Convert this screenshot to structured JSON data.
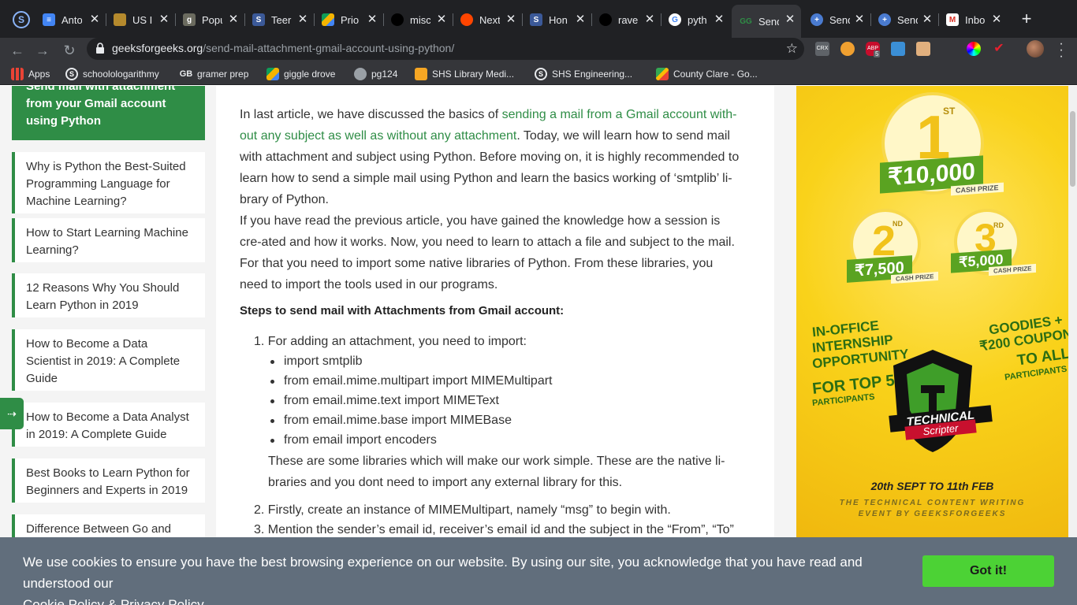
{
  "browser": {
    "app_icon": "S",
    "tabs": [
      {
        "title": "Anto",
        "favicon": "docs-icon",
        "color": "#4285f4"
      },
      {
        "title": "US I",
        "favicon": "folder-icon",
        "color": "#b58a2d"
      },
      {
        "title": "Popu",
        "favicon": "g-icon",
        "color": "#6b6b5f"
      },
      {
        "title": "Teer",
        "favicon": "s-icon",
        "color": "#3b5998"
      },
      {
        "title": "Prio",
        "favicon": "drive-icon",
        "color": "#0f9d58"
      },
      {
        "title": "misc",
        "favicon": "github-icon",
        "color": "#000000"
      },
      {
        "title": "Next",
        "favicon": "reddit-icon",
        "color": "#ff4500"
      },
      {
        "title": "Hon",
        "favicon": "s-icon",
        "color": "#3b5998"
      },
      {
        "title": "rave",
        "favicon": "github-icon",
        "color": "#000000"
      },
      {
        "title": "pyth",
        "favicon": "google-icon",
        "color": "#ffffff"
      },
      {
        "title": "Send",
        "favicon": "gfg-icon",
        "color": "#2f8d46",
        "active": true
      },
      {
        "title": "Send",
        "favicon": "medical-icon",
        "color": "#4a7bd0"
      },
      {
        "title": "Send",
        "favicon": "medical-icon",
        "color": "#4a7bd0"
      },
      {
        "title": "Inbo",
        "favicon": "gmail-icon",
        "color": "#d93025"
      }
    ],
    "url_domain": "geeksforgeeks.org",
    "url_path": "/send-mail-attachment-gmail-account-using-python/",
    "extensions": [
      "crx-icon",
      "owl-icon",
      "abp-icon",
      "check-icon",
      "box-icon",
      "spacer-icon",
      "colorwheel-icon",
      "sword-icon"
    ],
    "abp_badge": "5",
    "bookmarks": [
      {
        "label": "Apps",
        "icon": "apps-grid-icon"
      },
      {
        "label": "schoolologarithmy",
        "icon": "s-icon"
      },
      {
        "label": "gramer prep",
        "icon": "gb-icon"
      },
      {
        "label": "giggle drove",
        "icon": "drive-icon"
      },
      {
        "label": "pg124",
        "icon": "globe-icon"
      },
      {
        "label": "SHS Library Medi...",
        "icon": "bookmark-icon"
      },
      {
        "label": "SHS Engineering...",
        "icon": "s-icon"
      },
      {
        "label": "County Clare - Go...",
        "icon": "maps-icon"
      }
    ]
  },
  "sidebar": {
    "current": "Send mail with attachment from your Gmail account using Python",
    "items": [
      "Why is Python the Best-Suited Programming Language for Machine Learning?",
      "How to Start Learning Machine Learning?",
      "12 Reasons Why You Should Learn Python in 2019",
      "How to Become a Data Scientist in 2019: A Complete Guide",
      "How to Become a Data Analyst in 2019: A Complete Guide",
      "Best Books to Learn Python for Beginners and Experts in 2019",
      "Difference Between Go and"
    ],
    "feedback_icon": "arrow-right-icon"
  },
  "article": {
    "p1_a": "In last article, we have discussed the basics of ",
    "p1_link": "sending a mail from a Gmail account with-out any subject as well as without any attachment",
    "p1_b": ". Today, we will learn how to send mail with attachment and subject using Python. Before moving on, it is highly recommended to learn how to send a simple mail using Python and learn the basics working of ‘smtplib’ li-brary of Python.",
    "p2": "If you have read the previous article, you have gained the knowledge how a session is cre-ated and how it works. Now, you need to learn to attach a file and subject to the mail. For that you need to import some native libraries of Python. From these libraries, you need to import the tools used in our programs.",
    "steps_title": "Steps to send mail with Attachments from Gmail account:",
    "step1": "1. For adding an attachment, you need to import:",
    "imports": [
      "import smtplib",
      "from email.mime.multipart import MIMEMultipart",
      "from email.mime.text import MIMEText",
      "from email.mime.base import MIMEBase",
      "from email import encoders"
    ],
    "note": "These are some libraries which will make our work simple. These are the native li-braries and you dont need to import any external library for this.",
    "step2": "2. Firstly, create an instance of MIMEMultipart, namely “msg” to begin with.",
    "step3": "3. Mention the sender’s email id, receiver’s email id and the subject in the “From”, “To”"
  },
  "ad": {
    "first_rank": "1",
    "first_suffix": "ST",
    "first_prize": "₹10,000",
    "cash_prize": "CASH PRIZE",
    "second_rank": "2",
    "second_suffix": "ND",
    "second_prize": "₹7,500",
    "third_rank": "3",
    "third_suffix": "RD",
    "third_prize": "₹5,000",
    "left_text_1": "IN-OFFICE",
    "left_text_2": "INTERNSHIP",
    "left_text_3": "OPPORTUNITY",
    "left_text_4": "FOR TOP 50",
    "left_text_5": "PARTICIPANTS",
    "right_text_1": "GOODIES +",
    "right_text_2": "₹200 COUPON",
    "right_text_3": "TO ALL",
    "right_text_4": "PARTICIPANTS",
    "logo_text_1": "TECHNICAL",
    "logo_text_2": "Scripter",
    "dates": "20th SEPT TO 11th FEB",
    "tagline_1": "THE TECHNICAL CONTENT WRITING",
    "tagline_2": "EVENT BY GEEKSFORGEEKS"
  },
  "cookie": {
    "text": "We use cookies to ensure you have the best browsing experience on our website. By using our site, you acknowledge that you have read and understood our",
    "cookie_policy": "Cookie Policy",
    "amp": "&",
    "privacy_policy": "Privacy Policy",
    "button": "Got it!"
  }
}
